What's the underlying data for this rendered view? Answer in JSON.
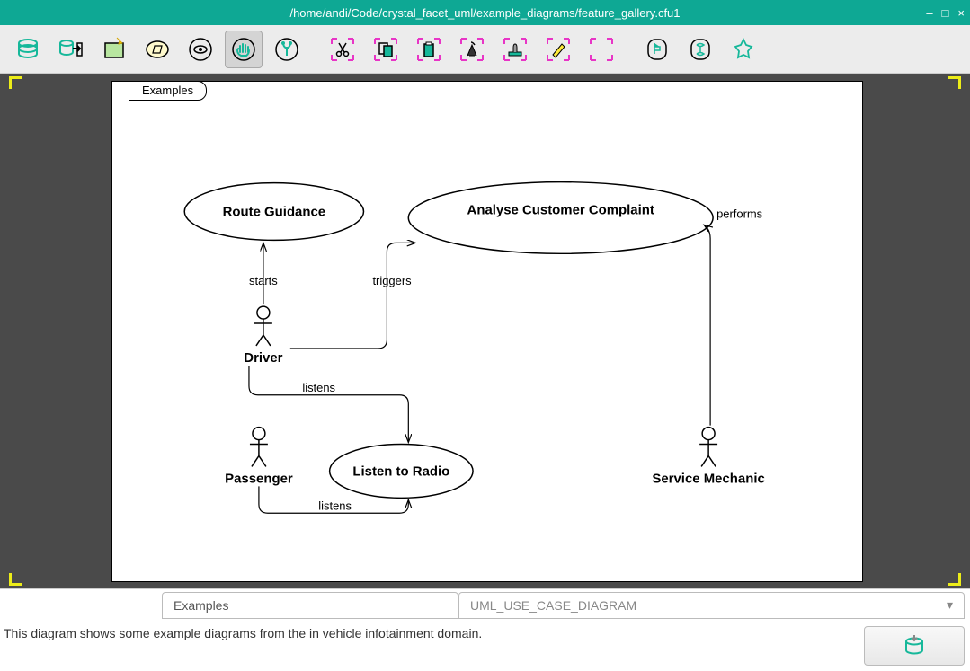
{
  "window": {
    "title": "/home/andi/Code/crystal_facet_uml/example_diagrams/feature_gallery.cfu1"
  },
  "toolbar": {
    "buttons": [
      {
        "name": "database-icon"
      },
      {
        "name": "export-icon"
      },
      {
        "name": "new-window-icon"
      },
      {
        "name": "folder-icon"
      },
      {
        "name": "view-icon"
      },
      {
        "name": "hand-icon",
        "selected": true
      },
      {
        "name": "plant-icon"
      },
      {
        "name": "cut-icon"
      },
      {
        "name": "copy-icon"
      },
      {
        "name": "paste-icon"
      },
      {
        "name": "delete-icon"
      },
      {
        "name": "stamp-icon"
      },
      {
        "name": "highlight-icon"
      },
      {
        "name": "resize-icon"
      },
      {
        "name": "undo-icon"
      },
      {
        "name": "redo-icon"
      },
      {
        "name": "about-icon"
      }
    ]
  },
  "diagram": {
    "tab_label": "Examples",
    "use_cases": {
      "route_guidance": "Route Guidance",
      "analyse_complaint": "Analyse Customer Complaint",
      "listen_radio": "Listen to Radio"
    },
    "actors": {
      "driver": "Driver",
      "passenger": "Passenger",
      "service_mechanic": "Service Mechanic"
    },
    "relations": {
      "starts": "starts",
      "triggers": "triggers",
      "performs": "performs",
      "listens1": "listens",
      "listens2": "listens"
    }
  },
  "bottom": {
    "name_field": "Examples",
    "type_select": "UML_USE_CASE_DIAGRAM",
    "description": "This diagram shows some example diagrams from the in vehicle infotainment domain."
  }
}
